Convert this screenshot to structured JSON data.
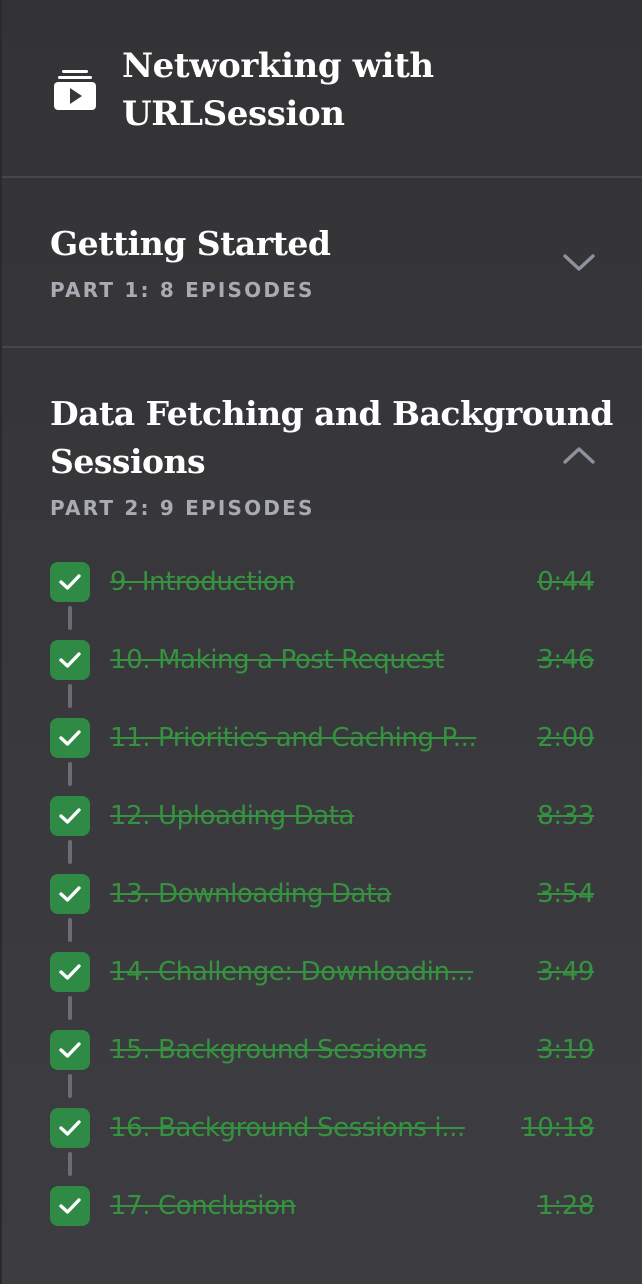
{
  "course": {
    "title_line1": "Networking with",
    "title_line2": "URLSession",
    "icon": "video-course-icon"
  },
  "parts": [
    {
      "title": "Getting Started",
      "subtitle": "PART 1: 8 EPISODES",
      "expanded": false,
      "chevron_icon": "chevron-down-icon"
    },
    {
      "title_line1": "Data Fetching and Background",
      "title_line2": "Sessions",
      "subtitle": "PART 2: 9 EPISODES",
      "expanded": true,
      "chevron_icon": "chevron-up-icon",
      "episodes": [
        {
          "title": "9. Introduction",
          "duration": "0:44",
          "completed": true
        },
        {
          "title": "10. Making a Post Request",
          "duration": "3:46",
          "completed": true
        },
        {
          "title": "11. Priorities and Caching P...",
          "duration": "2:00",
          "completed": true
        },
        {
          "title": "12. Uploading Data",
          "duration": "8:33",
          "completed": true
        },
        {
          "title": "13. Downloading Data",
          "duration": "3:54",
          "completed": true
        },
        {
          "title": "14. Challenge: Downloadin...",
          "duration": "3:49",
          "completed": true
        },
        {
          "title": "15. Background Sessions",
          "duration": "3:19",
          "completed": true
        },
        {
          "title": "16. Background Sessions i...",
          "duration": "10:18",
          "completed": true
        },
        {
          "title": "17. Conclusion",
          "duration": "1:28",
          "completed": true
        }
      ]
    }
  ],
  "colors": {
    "background": "#38383c",
    "completed_green": "#35923f",
    "check_bg": "#2f8a46",
    "subtitle_gray": "#a9abb3",
    "divider": "#46464b",
    "connector": "#6c6d74"
  }
}
